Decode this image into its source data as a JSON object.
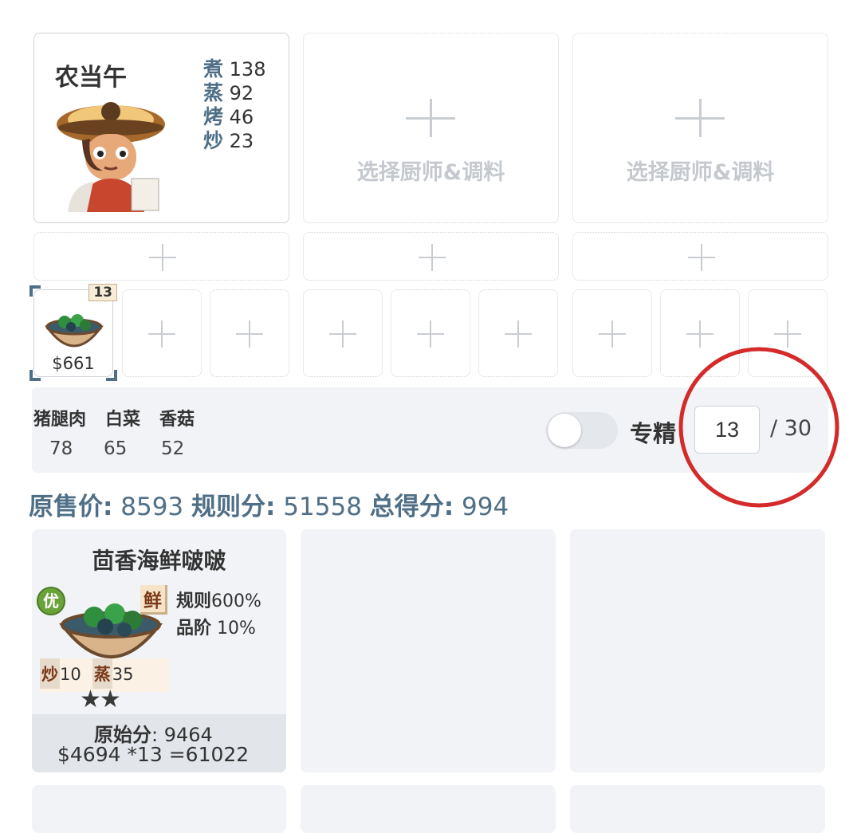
{
  "chef": {
    "name": "农当午",
    "skills": [
      {
        "label": "煮",
        "value": "138"
      },
      {
        "label": "蒸",
        "value": "92"
      },
      {
        "label": "烤",
        "value": "46"
      },
      {
        "label": "炒",
        "value": "23"
      }
    ]
  },
  "empty_slot_label": "选择厨师&调料",
  "recipe_slot": {
    "badge": "13",
    "price": "$661"
  },
  "ingredients": [
    {
      "name": "猪腿肉",
      "value": "78"
    },
    {
      "name": "白菜",
      "value": "65"
    },
    {
      "name": "香菇",
      "value": "52"
    }
  ],
  "specialize_label": "专精",
  "quantity": {
    "value": "13",
    "max": "/ 30"
  },
  "summary": {
    "original_price_label": "原售价:",
    "original_price": "8593",
    "rule_score_label": "规则分:",
    "rule_score": "51558",
    "total_score_label": "总得分:",
    "total_score": "994"
  },
  "dish": {
    "name": "茴香海鲜啵啵",
    "quality_badge": "优",
    "flavor_tag": "鲜",
    "rule_label": "规则",
    "rule_value": "600%",
    "grade_label": "品阶",
    "grade_value": "10%",
    "skills": [
      {
        "label": "炒",
        "value": "10"
      },
      {
        "label": "蒸",
        "value": "35"
      }
    ],
    "stars": "★★",
    "raw_score_label": "原始分",
    "raw_score": ": 9464",
    "calc": "$4694 *13 =61022"
  },
  "colors": {
    "accent": "#4f6f86",
    "highlight_circle": "#d42a2a",
    "panel": "#f1f3f6"
  }
}
